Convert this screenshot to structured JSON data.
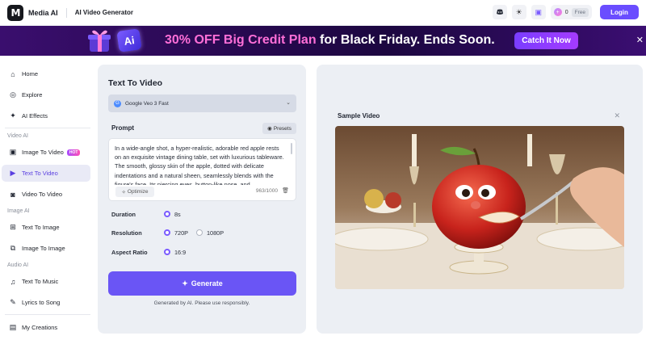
{
  "header": {
    "brand": "Media AI",
    "section": "AI Video Generator",
    "credits": "0",
    "plan_badge": "Free",
    "login_label": "Login",
    "icons": [
      "discord-icon",
      "theme-sun-icon",
      "gift-icon"
    ]
  },
  "banner": {
    "highlight": "30% OFF Big Credit Plan",
    "rest": "for Black Friday. Ends Soon.",
    "cta": "Catch It Now",
    "ai_badge": "Ai"
  },
  "sidebar": {
    "items": [
      {
        "label": "Home",
        "icon": "home-icon"
      },
      {
        "label": "Explore",
        "icon": "explore-icon"
      },
      {
        "label": "AI Effects",
        "icon": "sparkle-icon"
      }
    ],
    "groups": [
      {
        "title": "Video AI",
        "items": [
          {
            "label": "Image To Video",
            "icon": "image-video-icon",
            "badge": "HOT"
          },
          {
            "label": "Text To Video",
            "icon": "text-video-icon",
            "active": true
          },
          {
            "label": "Video To Video",
            "icon": "video-video-icon"
          }
        ]
      },
      {
        "title": "Image AI",
        "items": [
          {
            "label": "Text To Image",
            "icon": "text-image-icon"
          },
          {
            "label": "Image To Image",
            "icon": "image-image-icon"
          }
        ]
      },
      {
        "title": "Audio AI",
        "items": [
          {
            "label": "Text To Music",
            "icon": "music-icon"
          },
          {
            "label": "Lyrics to Song",
            "icon": "lyrics-icon"
          }
        ]
      }
    ],
    "footer_item": {
      "label": "My Creations",
      "icon": "creations-icon"
    }
  },
  "form": {
    "title": "Text To Video",
    "model": "Google Veo 3 Fast",
    "prompt_label": "Prompt",
    "presets_label": "Presets",
    "prompt_text": "In a wide-angle shot, a hyper-realistic, adorable red apple rests on an exquisite vintage dining table, set with luxurious tableware. The smooth, glossy skin of the apple, dotted with delicate indentations and a natural sheen, seamlessly blends with the figure's face. Its piercing eyes, button-like nose, and",
    "optimize_label": "Optimize",
    "char_count": "963/1000",
    "duration_label": "Duration",
    "duration_value": "8s",
    "resolution_label": "Resolution",
    "resolution_options": [
      "720P",
      "1080P"
    ],
    "resolution_selected": "720P",
    "aspect_label": "Aspect Ratio",
    "aspect_value": "16:9",
    "generate_label": "Generate",
    "disclaimer": "Generated by AI. Please use responsibly."
  },
  "sample": {
    "title": "Sample Video"
  }
}
